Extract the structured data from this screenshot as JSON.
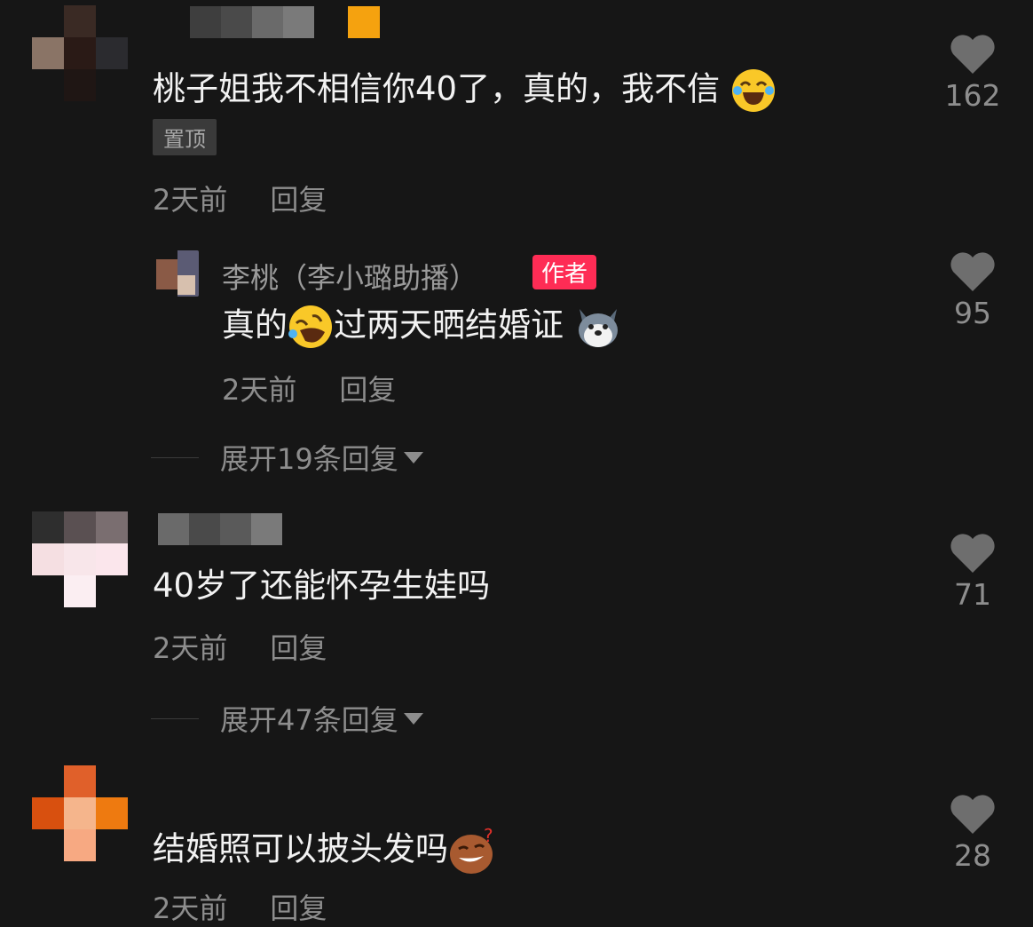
{
  "comments": [
    {
      "text": "桃子姐我不相信你40了，真的，我不信",
      "emoji": "tears-of-joy",
      "pinned_label": "置顶",
      "time": "2天前",
      "reply_label": "回复",
      "likes": "162",
      "reply": {
        "author": "李桃（李小璐助播）",
        "badge": "作者",
        "text_before": "真的",
        "emoji1": "rolling-laughing",
        "text_after": "过两天晒结婚证",
        "emoji2": "husky-dog",
        "time": "2天前",
        "reply_label": "回复",
        "likes": "95"
      },
      "expand_label": "展开19条回复"
    },
    {
      "text": "40岁了还能怀孕生娃吗",
      "time": "2天前",
      "reply_label": "回复",
      "likes": "71",
      "expand_label": "展开47条回复"
    },
    {
      "text": "结婚照可以披头发吗",
      "emoji": "smirk-question",
      "time": "2天前",
      "reply_label": "回复",
      "likes": "28"
    }
  ],
  "colors": {
    "background": "#161616",
    "author_badge": "#fe2c55",
    "secondary_text": "#8d8d8d",
    "like_icon": "#6e6e6e"
  }
}
